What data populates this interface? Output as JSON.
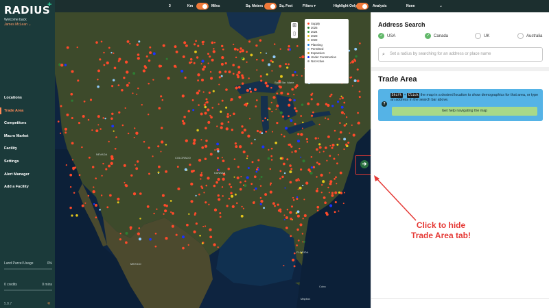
{
  "sidebar": {
    "logo": "RADIUS",
    "logo_plus": "+",
    "welcome": "Welcome back",
    "user": "James McLean ⌄",
    "nav": [
      {
        "label": "Locations",
        "active": false
      },
      {
        "label": "Trade Area",
        "active": true
      },
      {
        "label": "Competitors",
        "active": false
      },
      {
        "label": "Macro Market",
        "active": false
      },
      {
        "label": "Facility",
        "active": false
      },
      {
        "label": "Settings",
        "active": false
      },
      {
        "label": "Alert Manager",
        "active": false
      },
      {
        "label": "Add a Facility",
        "active": false
      }
    ],
    "land_parcel_label": "Land Parcel Usage",
    "land_parcel_value": "0%",
    "credits_label": "0 credits",
    "mins_label": "0 mins",
    "version": "5.8.7",
    "collapse_glyph": "«"
  },
  "topbar": {
    "radius_value": "3",
    "km_label": "Km",
    "miles_label": "Miles",
    "sqm_label": "Sq. Meters",
    "sqft_label": "Sq. Feet",
    "filters_label": "Filters ▾",
    "highlight_label": "Highlight Only",
    "analysis_label": "Analysis",
    "none_label": "None",
    "dropdown_glyph": "⌄"
  },
  "map": {
    "legend": [
      {
        "label": "Supply",
        "color": "#ff4a2a"
      },
      {
        "label": "2025",
        "color": "#2e7d32"
      },
      {
        "label": "2024",
        "color": "#43a047"
      },
      {
        "label": "2023",
        "color": "#e2c51b"
      },
      {
        "label": "2022",
        "color": "#d4c24a"
      },
      {
        "label": "Planning",
        "color": "#1e88e5"
      },
      {
        "label": "Permitted",
        "color": "#90caf9"
      },
      {
        "label": "Expansion",
        "color": "#c99a2c"
      },
      {
        "label": "Under Construction",
        "color": "#1a33ff"
      },
      {
        "label": "Not Active",
        "color": "#9e9e9e"
      }
    ],
    "labels": {
      "sault": "Sault Ste. Marie",
      "nevada": "NEVADA",
      "colorado": "COLORADO",
      "kansas": "KANSAS",
      "florida": "FLORIDA",
      "mexico": "MEXICO",
      "cuba": "Cuba",
      "credit": "Mapbox"
    },
    "tool_grid_icon": "⊞",
    "tool_phone_icon": "▯",
    "toggle_glyph": "➔"
  },
  "panel": {
    "address_title": "Address Search",
    "countries": [
      {
        "label": "USA",
        "checked": true
      },
      {
        "label": "Canada",
        "checked": true
      },
      {
        "label": "UK",
        "checked": false
      },
      {
        "label": "Australia",
        "checked": false
      }
    ],
    "search_placeholder": "Set a radius by searching for an address or place name",
    "search_icon": "⌕",
    "trade_title": "Trade Area",
    "key_shift": "Shift",
    "key_plus": "+",
    "key_click": "Click",
    "info_text": "the map in a desired location to show demographics for that area, or type an address in the search bar above.",
    "help_button": "Get help navigating the map",
    "help_icon": "?"
  },
  "annotation": {
    "line1": "Click to hide",
    "line2": "Trade Area tab!"
  }
}
